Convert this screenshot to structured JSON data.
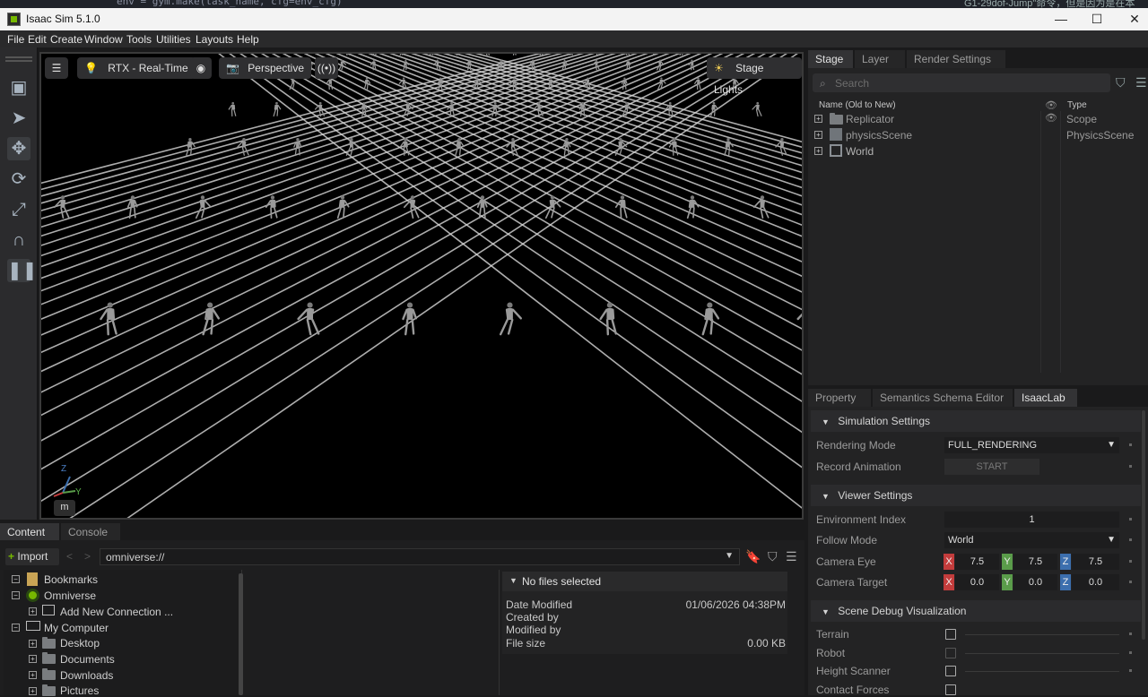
{
  "top_strip": {
    "code_text": "env = gym.make(task_name, cfg=env_cfg)",
    "cn_text": "G1-29dof-Jump\"命令，但是因为是在本"
  },
  "window": {
    "title": "Isaac Sim 5.1.0",
    "minimize": "—",
    "maximize": "☐",
    "close": "✕"
  },
  "menu": [
    "File",
    "Edit",
    "Create",
    "Window",
    "Tools",
    "Utilities",
    "Layouts",
    "Help"
  ],
  "viewport": {
    "render_mode": "RTX - Real-Time",
    "camera": "Perspective",
    "lights": "Stage Lights",
    "axis_z": "Z",
    "axis_y": "Y",
    "nav_key": "m",
    "robot_rows": 9,
    "robot_cols": 13,
    "grid_cells": 12
  },
  "stage": {
    "tabs": [
      "Stage",
      "Layer",
      "Render Settings"
    ],
    "search_placeholder": "Search",
    "col_name": "Name (Old to New)",
    "col_type": "Type",
    "rows": [
      {
        "name": "Replicator",
        "type": "Scope"
      },
      {
        "name": "physicsScene",
        "type": "PhysicsScene"
      },
      {
        "name": "World",
        "type": ""
      }
    ]
  },
  "property": {
    "tabs": [
      "Property",
      "Semantics Schema Editor",
      "IsaacLab"
    ],
    "simulation": {
      "title": "Simulation Settings",
      "rendering_mode_label": "Rendering Mode",
      "rendering_mode_value": "FULL_RENDERING",
      "record_label": "Record Animation",
      "record_button": "START"
    },
    "viewer": {
      "title": "Viewer Settings",
      "env_index_label": "Environment Index",
      "env_index_value": "1",
      "follow_label": "Follow Mode",
      "follow_value": "World",
      "eye_label": "Camera Eye",
      "eye": [
        "7.5",
        "7.5",
        "7.5"
      ],
      "target_label": "Camera Target",
      "target": [
        "0.0",
        "0.0",
        "0.0"
      ],
      "axes": [
        "X",
        "Y",
        "Z"
      ]
    },
    "debug": {
      "title": "Scene Debug Visualization",
      "items": [
        "Terrain",
        "Robot",
        "Height Scanner",
        "Contact Forces"
      ]
    }
  },
  "content": {
    "tabs": [
      "Content",
      "Console"
    ],
    "import_label": "Import",
    "path": "omniverse://",
    "tree": {
      "bookmarks": "Bookmarks",
      "omniverse": "Omniverse",
      "add_connection": "Add New Connection ...",
      "my_computer": "My Computer",
      "desktop": "Desktop",
      "documents": "Documents",
      "downloads": "Downloads",
      "pictures": "Pictures"
    },
    "detail": {
      "header": "No files selected",
      "date_modified_label": "Date Modified",
      "date_modified_value": "01/06/2026 04:38PM",
      "created_by_label": "Created by",
      "modified_by_label": "Modified by",
      "file_size_label": "File size",
      "file_size_value": "0.00 KB"
    }
  },
  "colors": {
    "x_axis": "#c33c3c",
    "y_axis": "#5a9c4a",
    "z_axis": "#3c6fae",
    "accent": "#76b900"
  }
}
